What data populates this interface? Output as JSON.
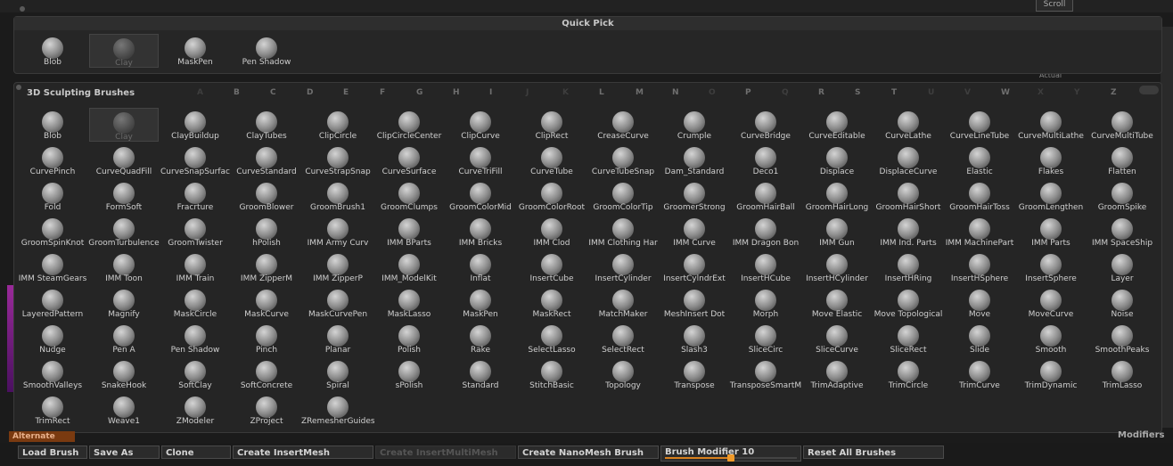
{
  "top": {
    "scroll_label": "Scroll",
    "actual_label": "Actual"
  },
  "quick_pick": {
    "title": "Quick Pick",
    "items": [
      {
        "label": "Blob",
        "selected": false
      },
      {
        "label": "Clay",
        "selected": true
      },
      {
        "label": "MaskPen",
        "selected": false
      },
      {
        "label": "Pen Shadow",
        "selected": false
      }
    ]
  },
  "sculpt": {
    "title": "3D Sculpting Brushes",
    "letters": [
      {
        "letter": "A",
        "available": false
      },
      {
        "letter": "B",
        "available": true
      },
      {
        "letter": "C",
        "available": true
      },
      {
        "letter": "D",
        "available": true
      },
      {
        "letter": "E",
        "available": true
      },
      {
        "letter": "F",
        "available": true
      },
      {
        "letter": "G",
        "available": true
      },
      {
        "letter": "H",
        "available": true
      },
      {
        "letter": "I",
        "available": true
      },
      {
        "letter": "J",
        "available": false
      },
      {
        "letter": "K",
        "available": false
      },
      {
        "letter": "L",
        "available": true
      },
      {
        "letter": "M",
        "available": true
      },
      {
        "letter": "N",
        "available": true
      },
      {
        "letter": "O",
        "available": false
      },
      {
        "letter": "P",
        "available": true
      },
      {
        "letter": "Q",
        "available": false
      },
      {
        "letter": "R",
        "available": true
      },
      {
        "letter": "S",
        "available": true
      },
      {
        "letter": "T",
        "available": true
      },
      {
        "letter": "U",
        "available": false
      },
      {
        "letter": "V",
        "available": false
      },
      {
        "letter": "W",
        "available": true
      },
      {
        "letter": "X",
        "available": false
      },
      {
        "letter": "Y",
        "available": false
      },
      {
        "letter": "Z",
        "available": true
      }
    ],
    "selected": "Clay",
    "brushes": [
      "Blob",
      "Clay",
      "ClayBuildup",
      "ClayTubes",
      "ClipCircle",
      "ClipCircleCenter",
      "ClipCurve",
      "ClipRect",
      "CreaseCurve",
      "Crumple",
      "CurveBridge",
      "CurveEditable",
      "CurveLathe",
      "CurveLineTube",
      "CurveMultiLathe",
      "CurveMultiTube",
      "CurvePinch",
      "CurveQuadFill",
      "CurveSnapSurfac",
      "CurveStandard",
      "CurveStrapSnap",
      "CurveSurface",
      "CurveTriFill",
      "CurveTube",
      "CurveTubeSnap",
      "Dam_Standard",
      "Deco1",
      "Displace",
      "DisplaceCurve",
      "Elastic",
      "Flakes",
      "Flatten",
      "Fold",
      "FormSoft",
      "Fracrture",
      "GroomBlower",
      "GroomBrush1",
      "GroomClumps",
      "GroomColorMid",
      "GroomColorRoot",
      "GroomColorTip",
      "GroomerStrong",
      "GroomHairBall",
      "GroomHairLong",
      "GroomHairShort",
      "GroomHairToss",
      "GroomLengthen",
      "GroomSpike",
      "GroomSpinKnot",
      "GroomTurbulence",
      "GroomTwister",
      "hPolish",
      "IMM Army Curv",
      "IMM BParts",
      "IMM Bricks",
      "IMM Clod",
      "IMM Clothing Har",
      "IMM Curve",
      "IMM Dragon Bon",
      "IMM Gun",
      "IMM Ind. Parts",
      "IMM MachinePart",
      "IMM Parts",
      "IMM SpaceShip",
      "IMM SteamGears",
      "IMM Toon",
      "IMM Train",
      "IMM ZipperM",
      "IMM ZipperP",
      "IMM_ModelKit",
      "Inflat",
      "InsertCube",
      "InsertCylinder",
      "InsertCylndrExt",
      "InsertHCube",
      "InsertHCylinder",
      "InsertHRing",
      "InsertHSphere",
      "InsertSphere",
      "Layer",
      "LayeredPattern",
      "Magnify",
      "MaskCircle",
      "MaskCurve",
      "MaskCurvePen",
      "MaskLasso",
      "MaskPen",
      "MaskRect",
      "MatchMaker",
      "MeshInsert Dot",
      "Morph",
      "Move Elastic",
      "Move Topological",
      "Move",
      "MoveCurve",
      "Noise",
      "Nudge",
      "Pen A",
      "Pen Shadow",
      "Pinch",
      "Planar",
      "Polish",
      "Rake",
      "SelectLasso",
      "SelectRect",
      "Slash3",
      "SliceCirc",
      "SliceCurve",
      "SliceRect",
      "Slide",
      "Smooth",
      "SmoothPeaks",
      "SmoothValleys",
      "SnakeHook",
      "SoftClay",
      "SoftConcrete",
      "Spiral",
      "sPolish",
      "Standard",
      "StitchBasic",
      "Topology",
      "Transpose",
      "TransposeSmartM",
      "TrimAdaptive",
      "TrimCircle",
      "TrimCurve",
      "TrimDynamic",
      "TrimLasso",
      "TrimRect",
      "Weave1",
      "ZModeler",
      "ZProject",
      "ZRemesherGuides"
    ]
  },
  "side": {
    "alternate_label": "Alternate",
    "modifiers_label": "Modifiers"
  },
  "bottom": {
    "buttons": [
      {
        "label": "Load Brush",
        "disabled": false
      },
      {
        "label": "Save As",
        "disabled": false
      },
      {
        "label": "Clone",
        "disabled": false
      },
      {
        "label": "Create InsertMesh",
        "disabled": false
      },
      {
        "label": "Create InsertMultiMesh",
        "disabled": true
      },
      {
        "label": "Create NanoMesh Brush",
        "disabled": false
      }
    ],
    "modifier": {
      "label": "Brush Modifier",
      "value": 10,
      "fraction": 0.5
    },
    "reset_label": "Reset All Brushes"
  }
}
